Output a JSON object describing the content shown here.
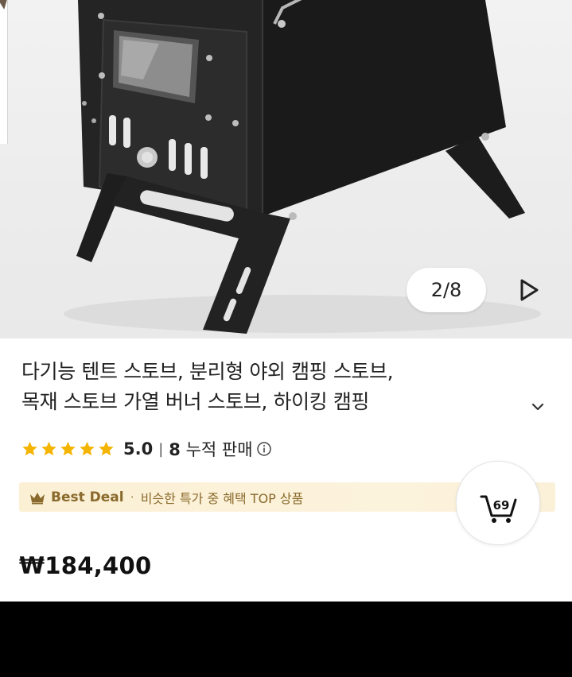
{
  "gallery": {
    "counter": "2/8"
  },
  "product": {
    "title_line1": "다기능 텐트 스토브, 분리형 야외 캠핑 스토브,",
    "title_line2": "목재 스토브 가열 버너 스토브, 하이킹 캠핑",
    "rating": "5.0",
    "rating_stars": 5,
    "sold_count": "8",
    "sold_label": "누적 판매",
    "price": "₩184,400"
  },
  "deal": {
    "label": "Best Deal",
    "separator": "·",
    "description": "비슷한 특가 중 혜택 TOP 상품"
  },
  "cart": {
    "count": "69"
  },
  "colors": {
    "star": "#f4b400",
    "deal_text": "#8a6a2c",
    "deal_bg": "#fbf0d4"
  },
  "icons": [
    "play-next-icon",
    "chevron-down-icon",
    "star-icon",
    "info-icon",
    "crown-icon",
    "cart-icon"
  ]
}
